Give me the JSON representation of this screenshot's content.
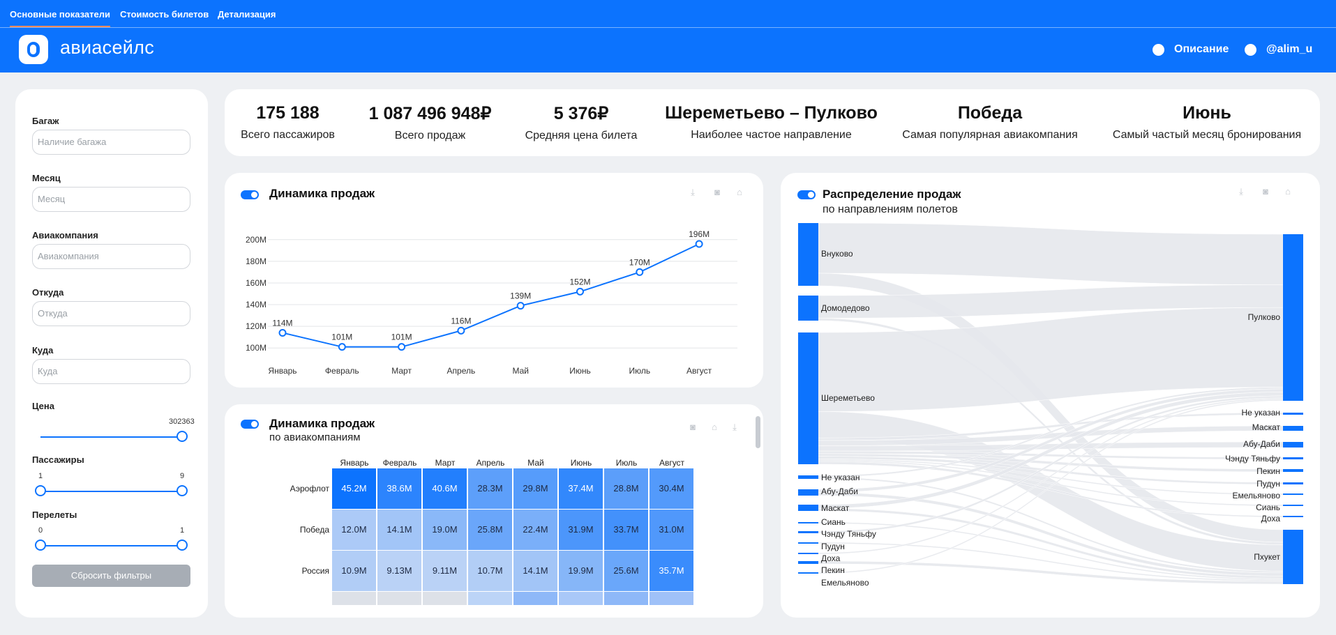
{
  "tabs": [
    "Основные показатели",
    "Стоимость билетов",
    "Детализация"
  ],
  "brand": "авиасейлс",
  "header_links": {
    "description": "Описание",
    "telegram": "@alim_u"
  },
  "icons": {
    "github": "github-icon",
    "telegram": "telegram-icon",
    "download": "download-icon",
    "camera": "camera-icon",
    "home": "home-icon"
  },
  "filters": {
    "baggage": {
      "label": "Багаж",
      "placeholder": "Наличие багажа"
    },
    "month": {
      "label": "Месяц",
      "placeholder": "Месяц"
    },
    "airline": {
      "label": "Авиакомпания",
      "placeholder": "Авиакомпания"
    },
    "from": {
      "label": "Откуда",
      "placeholder": "Откуда"
    },
    "to": {
      "label": "Куда",
      "placeholder": "Куда"
    },
    "price": {
      "label": "Цена",
      "max": "302363"
    },
    "passengers": {
      "label": "Пассажиры",
      "min": "1",
      "max": "9"
    },
    "transfers": {
      "label": "Перелеты",
      "min": "0",
      "max": "1"
    },
    "reset": "Сбросить фильтры"
  },
  "kpis": [
    {
      "value": "175 188",
      "label": "Всего пассажиров"
    },
    {
      "value": "1 087 496 948₽",
      "label": "Всего продаж"
    },
    {
      "value": "5 376₽",
      "label": "Средняя цена билета"
    },
    {
      "value": "Шереметьево – Пулково",
      "label": "Наиболее частое направление"
    },
    {
      "value": "Победа",
      "label": "Самая популярная авиакомпания"
    },
    {
      "value": "Июнь",
      "label": "Самый частый месяц бронирования"
    }
  ],
  "line_card": {
    "title": "Динамика продаж"
  },
  "heat_card": {
    "title": "Динамика продаж",
    "subtitle": "по авиакомпаниям"
  },
  "sankey_card": {
    "title": "Распределение продаж",
    "subtitle": "по направлениям полетов"
  },
  "colors": {
    "accent": "#0c73fe",
    "background": "#eef0f3",
    "link_gray": "#e6e8ec"
  },
  "chart_data": [
    {
      "type": "line",
      "categories": [
        "Январь",
        "Февраль",
        "Март",
        "Апрель",
        "Май",
        "Июнь",
        "Июль",
        "Август"
      ],
      "values": [
        114,
        101,
        101,
        116,
        139,
        152,
        170,
        196
      ],
      "data_labels": [
        "114M",
        "101M",
        "101M",
        "116M",
        "139M",
        "152M",
        "170M",
        "196M"
      ],
      "yticks": [
        "100M",
        "120M",
        "140M",
        "160M",
        "180M",
        "200M"
      ],
      "ytick_values": [
        100,
        120,
        140,
        160,
        180,
        200
      ],
      "grid": true
    },
    {
      "type": "heatmap",
      "columns": [
        "Январь",
        "Февраль",
        "Март",
        "Апрель",
        "Май",
        "Июнь",
        "Июль",
        "Август"
      ],
      "rows": [
        "Аэрофлот",
        "Победа",
        "Россия"
      ],
      "cells": [
        [
          "45.2M",
          "38.6M",
          "40.6M",
          "28.3M",
          "29.8M",
          "37.4M",
          "28.8M",
          "30.4M"
        ],
        [
          "12.0M",
          "14.1M",
          "19.0M",
          "25.8M",
          "22.4M",
          "31.9M",
          "33.7M",
          "31.0M"
        ],
        [
          "10.9M",
          "9.13M",
          "9.11M",
          "10.7M",
          "14.1M",
          "19.9M",
          "25.6M",
          "35.7M"
        ]
      ],
      "values": [
        [
          45.2,
          38.6,
          40.6,
          28.3,
          29.8,
          37.4,
          28.8,
          30.4
        ],
        [
          12.0,
          14.1,
          19.0,
          25.8,
          22.4,
          31.9,
          33.7,
          31.0
        ],
        [
          10.9,
          9.13,
          9.11,
          10.7,
          14.1,
          19.9,
          25.6,
          35.7
        ]
      ]
    },
    {
      "type": "sankey",
      "sources": [
        "Внуково",
        "Домодедово",
        "Шереметьево",
        "Не указан",
        "Абу-Даби",
        "Маскат",
        "Сиань",
        "Чэнду Тяньфу",
        "Пудун",
        "Доха",
        "Пекин",
        "Емельяново"
      ],
      "targets": [
        "Пулково",
        "Не указан",
        "Маскат",
        "Абу-Даби",
        "Чэнду Тяньфу",
        "Пекин",
        "Пудун",
        "Емельяново",
        "Сиань",
        "Доха",
        "Пхукет"
      ]
    }
  ]
}
